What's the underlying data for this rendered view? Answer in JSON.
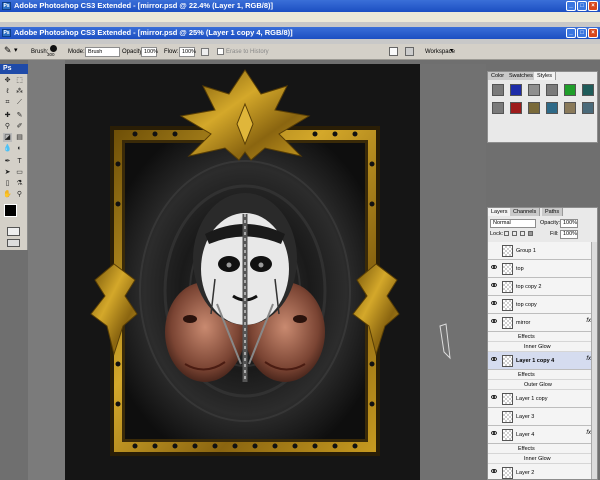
{
  "windows": {
    "app_title": "Adobe Photoshop CS3 Extended - [mirror.psd @ 22.4% (Layer 1, RGB/8)]",
    "doc_title": "Adobe Photoshop CS3 Extended - [mirror.psd @ 25% (Layer 1 copy 4, RGB/8)]",
    "min_glyph": "_",
    "max_glyph": "□",
    "close_glyph": "×"
  },
  "options_bar": {
    "brush_label": "Brush:",
    "brush_size": "300",
    "mode_label": "Mode:",
    "mode_value": "Brush",
    "opacity_label": "Opacity:",
    "opacity_value": "100%",
    "flow_label": "Flow:",
    "flow_value": "100%",
    "erase_history_label": "Erase to History",
    "workspace_label": "Workspace"
  },
  "toolbox": {
    "logo": "Ps"
  },
  "styles_panel": {
    "tabs": [
      "Color",
      "Swatches",
      "Styles"
    ],
    "active_tab": "Styles",
    "swatch_colors": [
      "#7a7a7a",
      "#1e2ca8",
      "#8f8f8f",
      "#7a7a7a",
      "#1f9d2a",
      "#1f5c5a",
      "#7a7a7a",
      "#9d1b1b",
      "#7a6a3a",
      "#2e6a88",
      "#8a7a5a",
      "#4a6a7a"
    ]
  },
  "layers_panel": {
    "tabs": [
      "Layers",
      "Channels",
      "Paths"
    ],
    "active_tab": "Layers",
    "blend_mode": "Normal",
    "opacity_label": "Opacity:",
    "opacity_value": "100%",
    "lock_label": "Lock:",
    "fill_label": "Fill:",
    "fill_value": "100%",
    "layers": [
      {
        "name": "Group 1",
        "visible": false
      },
      {
        "name": "top",
        "visible": true
      },
      {
        "name": "top copy 2",
        "visible": true
      },
      {
        "name": "top copy",
        "visible": true
      },
      {
        "name": "mirror",
        "visible": true,
        "fx": "fx",
        "effects_label": "Effects",
        "effect": "Inner Glow"
      },
      {
        "name": "Layer 1 copy 4",
        "visible": true,
        "selected": true,
        "fx": "fx",
        "effects_label": "Effects",
        "effect": "Outer Glow"
      },
      {
        "name": "Layer 1 copy",
        "visible": true
      },
      {
        "name": "Layer 3",
        "visible": false
      },
      {
        "name": "Layer 4",
        "visible": true,
        "fx": "fx",
        "effects_label": "Effects",
        "effect": "Inner Glow"
      },
      {
        "name": "Layer 2",
        "visible": true
      }
    ]
  },
  "colors": {
    "title_active": "#2456c8",
    "gold": "#b8901a",
    "panel_bg": "#e9e9e9",
    "selected_layer": "#d5dcef"
  }
}
